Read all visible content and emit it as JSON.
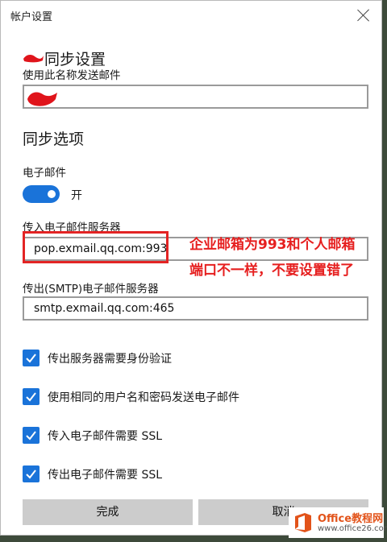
{
  "window": {
    "title": "帐户设置"
  },
  "sync_settings": {
    "heading": "同步设置",
    "sender_name_label": "使用此名称发送邮件",
    "sender_name_value": ""
  },
  "sync_options": {
    "heading": "同步选项",
    "email_label": "电子邮件",
    "email_toggle_state": "开",
    "email_toggle_on": true
  },
  "incoming_server": {
    "label": "传入电子邮件服务器",
    "value": "pop.exmail.qq.com:993"
  },
  "outgoing_server": {
    "label": "传出(SMTP)电子邮件服务器",
    "value": "smtp.exmail.qq.com:465"
  },
  "checkboxes": [
    {
      "label": "传出服务器需要身份验证",
      "checked": true
    },
    {
      "label": "使用相同的用户名和密码发送电子邮件",
      "checked": true
    },
    {
      "label": "传入电子邮件需要 SSL",
      "checked": true
    },
    {
      "label": "传出电子邮件需要 SSL",
      "checked": true
    }
  ],
  "buttons": {
    "done": "完成",
    "cancel": "取消"
  },
  "annotation": {
    "line1": "企业邮箱为993和个人邮箱",
    "line2": "端口不一样，不要设置错了"
  },
  "watermark": {
    "name": "Office教程网",
    "url": "www.office26.com"
  },
  "colors": {
    "accent": "#1a73d9",
    "annotation": "#e61f1f",
    "button": "#cccccc"
  }
}
